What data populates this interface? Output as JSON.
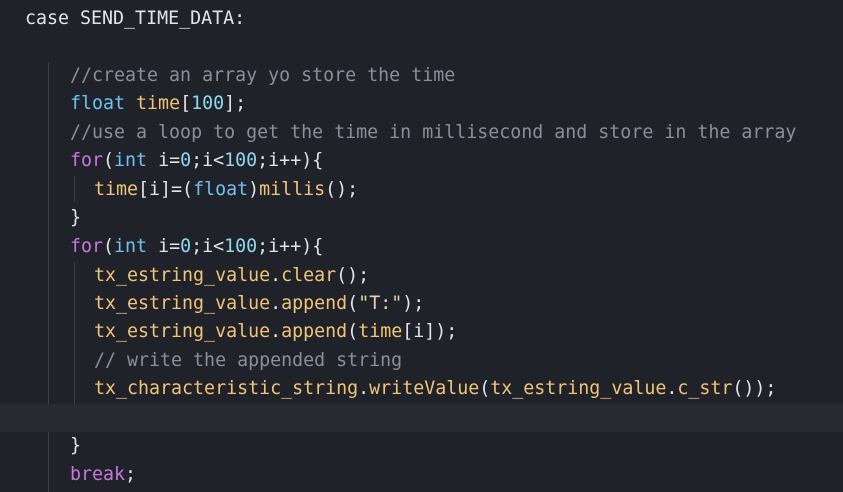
{
  "editor": {
    "lines": [
      [
        {
          "t": "case ",
          "c": "pl"
        },
        {
          "t": "SEND_TIME_DATA:",
          "c": "pl"
        }
      ],
      [],
      [
        {
          "t": "//create an array yo store the time",
          "c": "cm"
        }
      ],
      [
        {
          "t": "float ",
          "c": "ty"
        },
        {
          "t": "time",
          "c": "fn"
        },
        {
          "t": "[",
          "c": "pl"
        },
        {
          "t": "100",
          "c": "num"
        },
        {
          "t": "];",
          "c": "pl"
        }
      ],
      [
        {
          "t": "//use a loop to get the time in millisecond and store in the array",
          "c": "cm"
        }
      ],
      [
        {
          "t": "for",
          "c": "kw"
        },
        {
          "t": "(",
          "c": "pl"
        },
        {
          "t": "int ",
          "c": "ty"
        },
        {
          "t": "i=",
          "c": "pl"
        },
        {
          "t": "0",
          "c": "num"
        },
        {
          "t": ";i<",
          "c": "pl"
        },
        {
          "t": "100",
          "c": "num"
        },
        {
          "t": ";i++){",
          "c": "pl"
        }
      ],
      [
        {
          "t": "time",
          "c": "fn"
        },
        {
          "t": "[i]=(",
          "c": "pl"
        },
        {
          "t": "float",
          "c": "ty"
        },
        {
          "t": ")",
          "c": "pl"
        },
        {
          "t": "millis",
          "c": "fn"
        },
        {
          "t": "();",
          "c": "pl"
        }
      ],
      [
        {
          "t": "}",
          "c": "pl"
        }
      ],
      [
        {
          "t": "for",
          "c": "kw"
        },
        {
          "t": "(",
          "c": "pl"
        },
        {
          "t": "int ",
          "c": "ty"
        },
        {
          "t": "i=",
          "c": "pl"
        },
        {
          "t": "0",
          "c": "num"
        },
        {
          "t": ";i<",
          "c": "pl"
        },
        {
          "t": "100",
          "c": "num"
        },
        {
          "t": ";i++){",
          "c": "pl"
        }
      ],
      [
        {
          "t": "tx_estring_value",
          "c": "fn"
        },
        {
          "t": ".",
          "c": "pl"
        },
        {
          "t": "clear",
          "c": "fn"
        },
        {
          "t": "();",
          "c": "pl"
        }
      ],
      [
        {
          "t": "tx_estring_value",
          "c": "fn"
        },
        {
          "t": ".",
          "c": "pl"
        },
        {
          "t": "append",
          "c": "fn"
        },
        {
          "t": "(",
          "c": "pl"
        },
        {
          "t": "\"T:\"",
          "c": "str"
        },
        {
          "t": ");",
          "c": "pl"
        }
      ],
      [
        {
          "t": "tx_estring_value",
          "c": "fn"
        },
        {
          "t": ".",
          "c": "pl"
        },
        {
          "t": "append",
          "c": "fn"
        },
        {
          "t": "(",
          "c": "pl"
        },
        {
          "t": "time",
          "c": "fn"
        },
        {
          "t": "[i]);",
          "c": "pl"
        }
      ],
      [
        {
          "t": "// write the appended string",
          "c": "cm"
        }
      ],
      [
        {
          "t": "tx_characteristic_string",
          "c": "fn"
        },
        {
          "t": ".",
          "c": "pl"
        },
        {
          "t": "writeValue",
          "c": "fn"
        },
        {
          "t": "(",
          "c": "pl"
        },
        {
          "t": "tx_estring_value",
          "c": "fn"
        },
        {
          "t": ".",
          "c": "pl"
        },
        {
          "t": "c_str",
          "c": "fn"
        },
        {
          "t": "());",
          "c": "pl"
        }
      ],
      [],
      [
        {
          "t": "}",
          "c": "pl"
        }
      ],
      [
        {
          "t": "break",
          "c": "kw"
        },
        {
          "t": ";",
          "c": "pl"
        }
      ]
    ]
  }
}
